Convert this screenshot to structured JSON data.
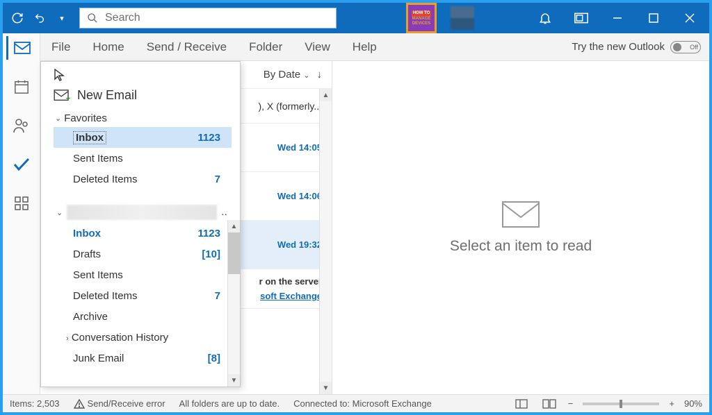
{
  "titlebar": {
    "search_placeholder": "Search",
    "logo_top": "HOW TO",
    "logo_bottom": "MANAGE DEVICES"
  },
  "menu": {
    "file": "File",
    "home": "Home",
    "sendreceive": "Send / Receive",
    "folder": "Folder",
    "view": "View",
    "help": "Help",
    "try_new": "Try the new Outlook",
    "toggle_off": "Off"
  },
  "listheader": {
    "bydate": "By Date",
    "sort_arrow": "↓"
  },
  "messages": {
    "m0_snip": "), X (formerly...",
    "m1_time": "Wed 14:05",
    "m2_time": "Wed 14:06",
    "m3_time": "Wed 19:32",
    "srv": "r on the server",
    "ex_link": "soft Exchange"
  },
  "readpane": {
    "placeholder": "Select an item to read"
  },
  "flyout": {
    "new_email": "New Email",
    "favorites": "Favorites",
    "fav_inbox": "Inbox",
    "fav_inbox_cnt": "1123",
    "fav_sent": "Sent Items",
    "fav_del": "Deleted Items",
    "fav_del_cnt": "7",
    "acct_inbox": "Inbox",
    "acct_inbox_cnt": "1123",
    "acct_drafts": "Drafts",
    "acct_drafts_cnt": "[10]",
    "acct_sent": "Sent Items",
    "acct_del": "Deleted Items",
    "acct_del_cnt": "7",
    "acct_arch": "Archive",
    "acct_conv": "Conversation History",
    "acct_junk": "Junk Email",
    "acct_junk_cnt": "[8]"
  },
  "status": {
    "items": "Items: 2,503",
    "error": "Send/Receive error",
    "uptodate": "All folders are up to date.",
    "connected": "Connected to: Microsoft Exchange",
    "zoom": "90%"
  }
}
